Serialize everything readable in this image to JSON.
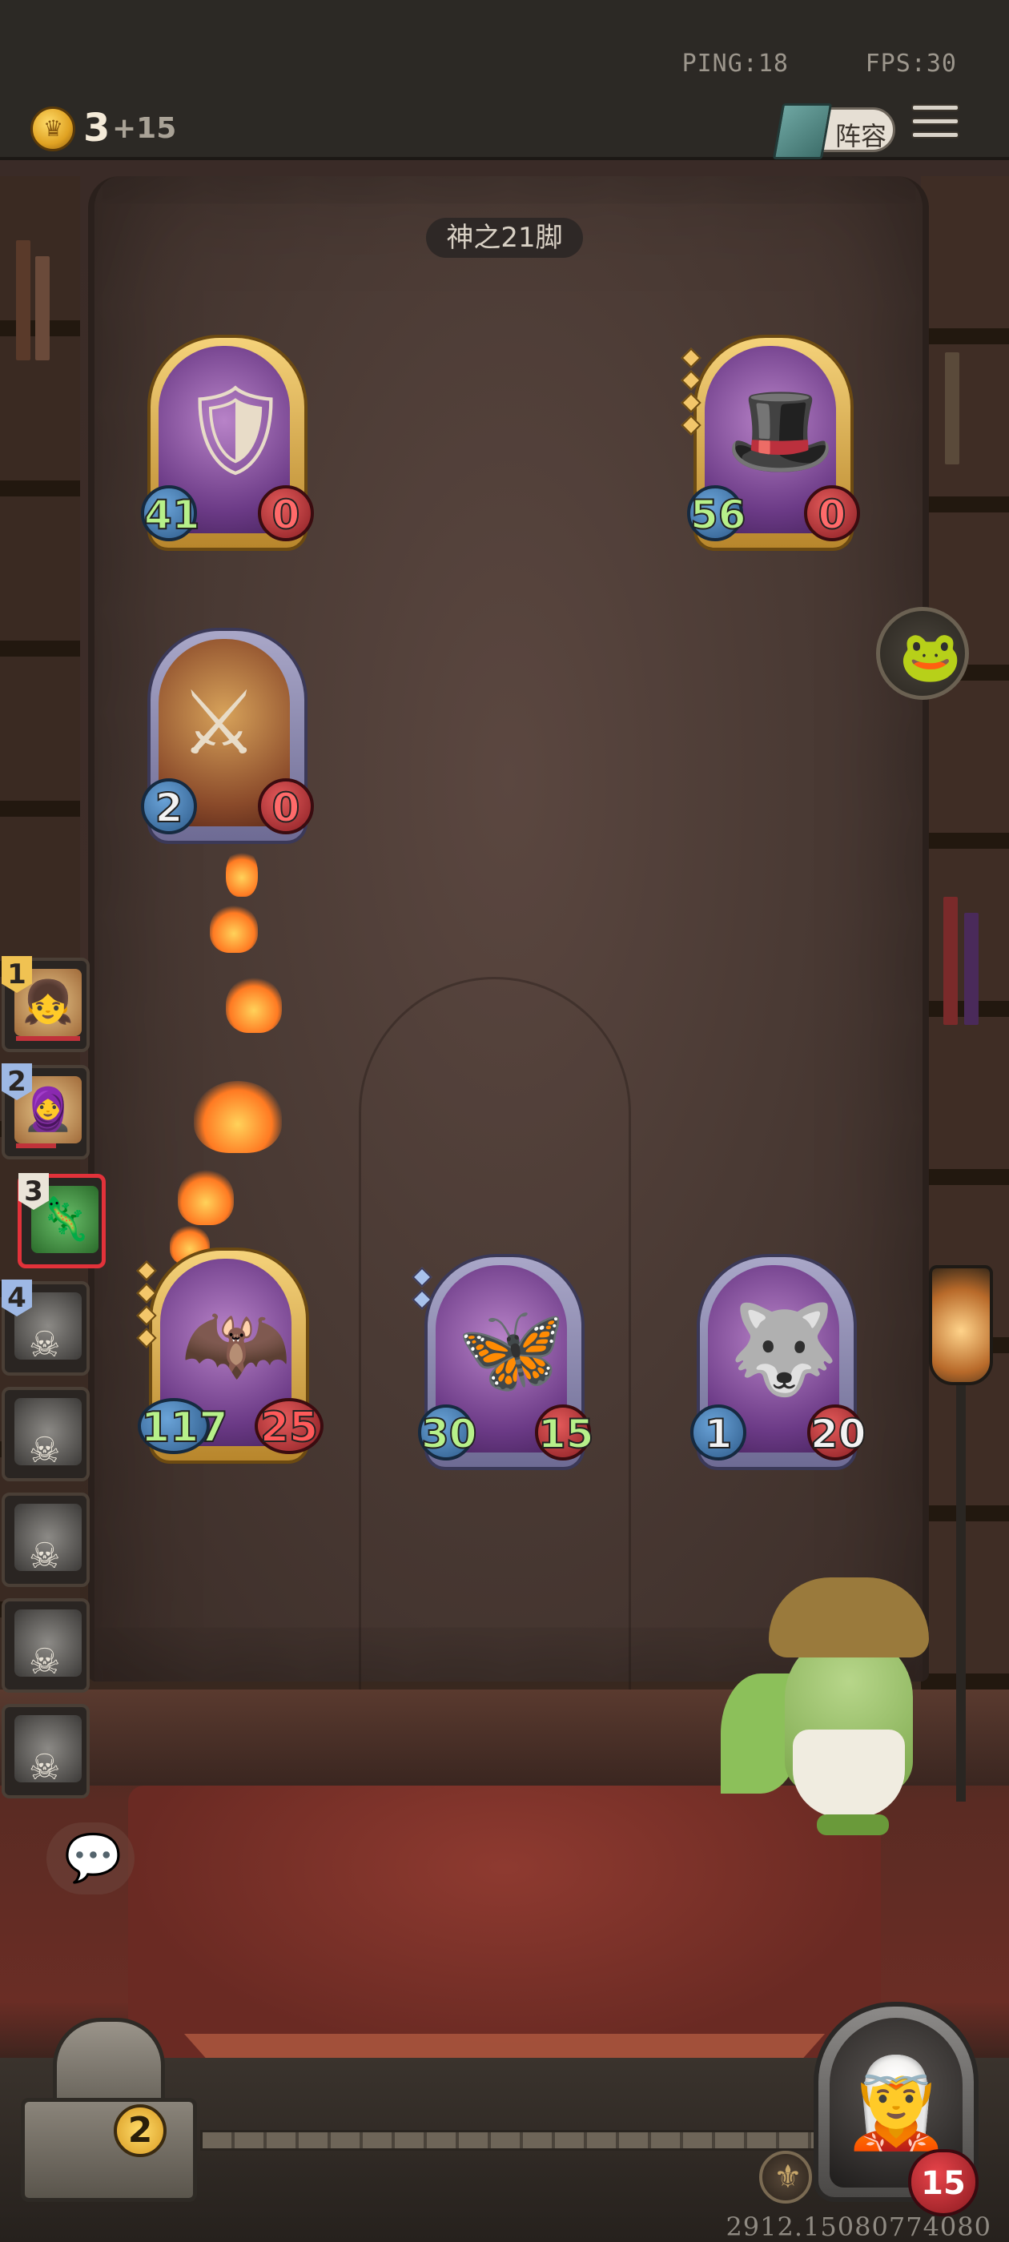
{
  "hud": {
    "ping": "PING:18",
    "fps": "FPS:30",
    "gold": "3",
    "gold_income": "+15",
    "lineup_label": "阵容"
  },
  "round_title": "神之21脚",
  "icons": {
    "coin": "coin-icon",
    "lineup": "lineup-book-icon",
    "menu": "menu-icon",
    "frog": "frog-icon",
    "chat": "chat-bubble-icon",
    "skill": "skill-icon",
    "skull": "skull-icon"
  },
  "colors": {
    "attack_green": "#b7f08a",
    "health_red": "#ff5a5a",
    "gold_frame": "#f5d27a",
    "silver_frame": "#a9a7c8",
    "selected_border": "#e2323a"
  },
  "enemy_board": [
    {
      "attack": "41",
      "health": "0",
      "frame": "gold",
      "tier_pips": 0
    },
    {
      "attack": "56",
      "health": "0",
      "frame": "gold",
      "tier_pips": 4
    },
    {
      "attack": "2",
      "health": "0",
      "frame": "silver",
      "tier_pips": 0
    }
  ],
  "player_board": [
    {
      "attack": "117",
      "health": "25",
      "frame": "gold",
      "tier_pips": 4
    },
    {
      "attack": "30",
      "health": "15",
      "frame": "silver",
      "tier_pips": 2
    },
    {
      "attack": "1",
      "health": "20",
      "frame": "silver",
      "tier_pips": 0
    }
  ],
  "roster": [
    {
      "rank": "1",
      "status": "alive"
    },
    {
      "rank": "2",
      "status": "alive"
    },
    {
      "rank": "3",
      "status": "selected"
    },
    {
      "rank": "4",
      "status": "eliminated"
    },
    {
      "rank": "",
      "status": "eliminated"
    },
    {
      "rank": "",
      "status": "eliminated"
    },
    {
      "rank": "",
      "status": "eliminated"
    },
    {
      "rank": "",
      "status": "eliminated"
    }
  ],
  "bottom": {
    "chest_count": "2",
    "player_health": "15",
    "version": "2912.15080774080"
  }
}
